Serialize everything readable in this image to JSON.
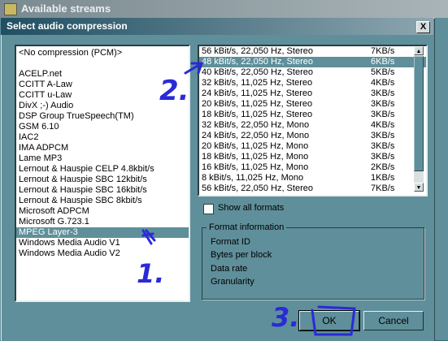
{
  "background_window": {
    "title": "Available streams"
  },
  "dialog": {
    "title": "Select audio compression",
    "close_label": "X",
    "codecs": [
      "<No compression (PCM)>",
      "",
      "ACELP.net",
      "CCITT A-Law",
      "CCITT u-Law",
      "DivX ;-) Audio",
      "DSP Group TrueSpeech(TM)",
      "GSM 6.10",
      "IAC2",
      "IMA ADPCM",
      "Lame MP3",
      "Lernout & Hauspie CELP 4.8kbit/s",
      "Lernout & Hauspie SBC 12kbit/s",
      "Lernout & Hauspie SBC 16kbit/s",
      "Lernout & Hauspie SBC 8kbit/s",
      "Microsoft ADPCM",
      "Microsoft G.723.1",
      "MPEG Layer-3",
      "Windows Media Audio V1",
      "Windows Media Audio V2"
    ],
    "selected_codec_index": 17,
    "formats": [
      {
        "desc": "56 kBit/s, 22,050 Hz, Stereo",
        "rate": "7KB/s"
      },
      {
        "desc": "48 kBit/s, 22,050 Hz, Stereo",
        "rate": "6KB/s"
      },
      {
        "desc": "40 kBit/s, 22,050 Hz, Stereo",
        "rate": "5KB/s"
      },
      {
        "desc": "32 kBit/s, 11,025 Hz, Stereo",
        "rate": "4KB/s"
      },
      {
        "desc": "24 kBit/s, 11,025 Hz, Stereo",
        "rate": "3KB/s"
      },
      {
        "desc": "20 kBit/s, 11,025 Hz, Stereo",
        "rate": "3KB/s"
      },
      {
        "desc": "18 kBit/s, 11,025 Hz, Stereo",
        "rate": "3KB/s"
      },
      {
        "desc": "32 kBit/s, 22,050 Hz, Mono",
        "rate": "4KB/s"
      },
      {
        "desc": "24 kBit/s, 22,050 Hz, Mono",
        "rate": "3KB/s"
      },
      {
        "desc": "20 kBit/s, 11,025 Hz, Mono",
        "rate": "3KB/s"
      },
      {
        "desc": "18 kBit/s, 11,025 Hz, Mono",
        "rate": "3KB/s"
      },
      {
        "desc": "16 kBit/s, 11,025 Hz, Mono",
        "rate": "2KB/s"
      },
      {
        "desc": "8 kBit/s, 11,025 Hz, Mono",
        "rate": "1KB/s"
      },
      {
        "desc": "56 kBit/s, 22,050 Hz, Stereo",
        "rate": "7KB/s"
      }
    ],
    "selected_format_index": 1,
    "show_all_formats": {
      "label": "Show all formats",
      "checked": false
    },
    "format_info": {
      "legend": "Format information",
      "labels": [
        "Format ID",
        "Bytes per block",
        "Data rate",
        "Granularity"
      ]
    },
    "buttons": {
      "ok": "OK",
      "cancel": "Cancel"
    }
  },
  "annotations": {
    "step1": "1.",
    "step2": "2.",
    "step3": "3."
  }
}
